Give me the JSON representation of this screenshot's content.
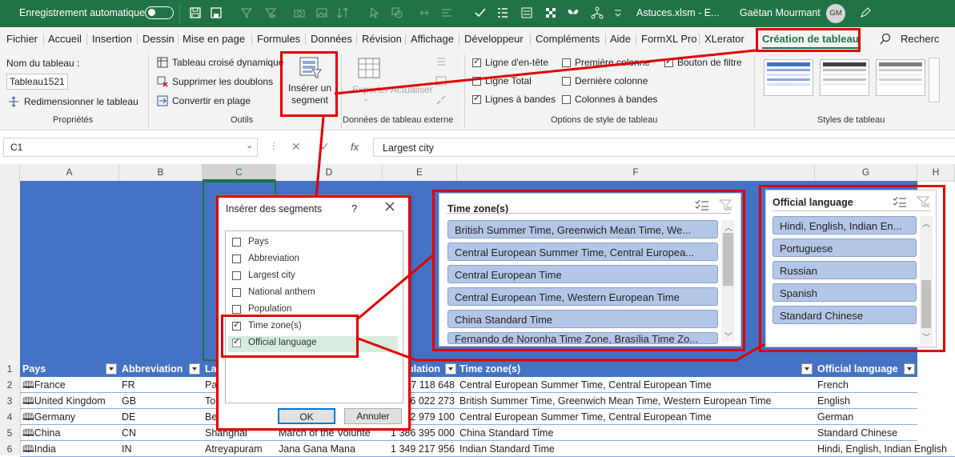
{
  "titlebar": {
    "autosave_label": "Enregistrement automatique",
    "filename": "Astuces.xlsm  -  E...",
    "user_name": "Gaëtan Mourmant",
    "user_initials": "GM"
  },
  "tabs": [
    "Fichier",
    "Accueil",
    "Insertion",
    "Dessin",
    "Mise en page",
    "Formules",
    "Données",
    "Révision",
    "Affichage",
    "Développeur",
    "Compléments",
    "Aide",
    "FormXL Pro",
    "XLerator",
    "Création de tableau"
  ],
  "search_label": "Recherc",
  "ribbon": {
    "table_name_label": "Nom du tableau :",
    "table_name_value": "Tableau1521",
    "resize": "Redimensionner le tableau",
    "props_group": "Propriétés",
    "pivot": "Tableau croisé dynamique",
    "remove_dups": "Supprimer les doublons",
    "convert_range": "Convertir en plage",
    "tools_group": "Outils",
    "insert_slicer": "Insérer un segment",
    "export": "Exporter",
    "refresh": "Actualiser",
    "ext_data_group": "Données de tableau externe",
    "opt_header_row": "Ligne d'en-tête",
    "opt_total_row": "Ligne Total",
    "opt_banded_rows": "Lignes à bandes",
    "opt_first_col": "Première colonne",
    "opt_last_col": "Dernière colonne",
    "opt_banded_cols": "Colonnes à bandes",
    "opt_filter_button": "Bouton de filtre",
    "style_opts_group": "Options de style de tableau",
    "styles_group": "Styles de tableau"
  },
  "formula": {
    "name_box": "C1",
    "fx": "fx",
    "content": "Largest city"
  },
  "columns": [
    "A",
    "B",
    "C",
    "D",
    "E",
    "F",
    "G",
    "H"
  ],
  "rows": [
    "1",
    "2",
    "3",
    "4",
    "5",
    "6"
  ],
  "table": {
    "headers": {
      "pays": "Pays",
      "abbreviation": "Abbreviation",
      "largest_city": "La",
      "population": "ulation",
      "timezone": "Time zone(s)",
      "language": "Official language"
    },
    "rows": [
      {
        "pays": "France",
        "abbr": "FR",
        "city": "Pa",
        "anthem": "",
        "pop": "7 118 648",
        "tz": "Central European Summer Time, Central European Time",
        "lang": "French"
      },
      {
        "pays": "United Kingdom",
        "abbr": "GB",
        "city": "To",
        "anthem": "",
        "pop": "6 022 273",
        "tz": "British Summer Time, Greenwich Mean Time, Western European Time",
        "lang": "English"
      },
      {
        "pays": "Germany",
        "abbr": "DE",
        "city": "Be",
        "anthem": "",
        "pop": "2 979 100",
        "tz": "Central European Summer Time, Central European Time",
        "lang": "German"
      },
      {
        "pays": "China",
        "abbr": "CN",
        "city": "Shanghai",
        "anthem": "March of the Volunte",
        "pop": "1 386 395 000",
        "tz": "China Standard Time",
        "lang": "Standard Chinese"
      },
      {
        "pays": "India",
        "abbr": "IN",
        "city": "Atreyapuram",
        "anthem": "Jana Gana Mana",
        "pop": "1 349 217 956",
        "tz": "Indian Standard Time",
        "lang": "Hindi, English, Indian English"
      }
    ]
  },
  "dialog": {
    "title": "Insérer des segments",
    "help": "?",
    "fields": [
      {
        "label": "Pays",
        "checked": false
      },
      {
        "label": "Abbreviation",
        "checked": false
      },
      {
        "label": "Largest city",
        "checked": false
      },
      {
        "label": "National anthem",
        "checked": false
      },
      {
        "label": "Population",
        "checked": false
      },
      {
        "label": "Time zone(s)",
        "checked": true
      },
      {
        "label": "Official language",
        "checked": true
      }
    ],
    "ok": "OK",
    "cancel": "Annuler"
  },
  "slicer_timezone": {
    "title": "Time zone(s)",
    "items": [
      "British Summer Time, Greenwich Mean Time, We...",
      "Central European Summer Time, Central Europea...",
      "Central European Time",
      "Central European Time, Western European Time",
      "China Standard Time",
      "Fernando de Noronha Time Zone, Brasília Time Zo..."
    ]
  },
  "slicer_language": {
    "title": "Official language",
    "items": [
      "Hindi, English, Indian En...",
      "Portuguese",
      "Russian",
      "Spanish",
      "Standard Chinese"
    ]
  },
  "colors": {
    "excel_green": "#217346",
    "table_blue": "#4472c4",
    "slicer_item": "#b4c6e7",
    "highlight_red": "#e00000"
  }
}
